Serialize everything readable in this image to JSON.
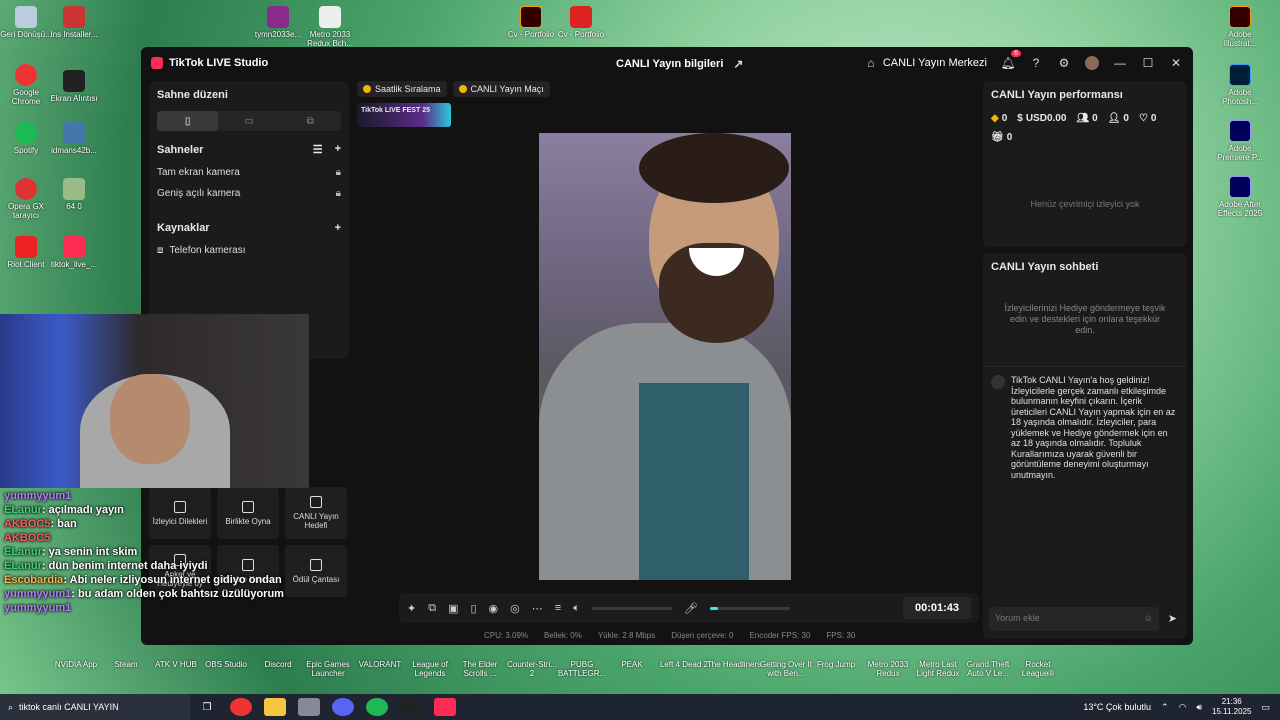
{
  "desktop": {
    "left_icons": [
      "Geri Dönüşü...",
      "Google Chrome",
      "Spotify",
      "Opera GX tarayıcı",
      "Riot Client"
    ],
    "top_icons": [
      "Ins Installer...",
      "tymn2033e...",
      "Metro 2033 Redux Bch...",
      "Cv - Portfolio",
      "Cv - Portfolio"
    ],
    "right_icons": [
      "Adobe Illustrat...",
      "Adobe Photosh...",
      "Adobe Premiere P...",
      "Adobe After Effects 2025"
    ],
    "second_col": [
      "Ekran Alıntısı",
      "idmans42b...",
      "64 0",
      "tiktok_live_..."
    ],
    "bottom_row": [
      "NVIDIA App",
      "Steam",
      "ATK V HUB",
      "OBS Studio",
      "Discord",
      "Epic Games Launcher",
      "VALORANT",
      "League of Legends",
      "The Elder Scrolls ...",
      "Counter-Stri... 2",
      "PUBG BATTLEGR...",
      "PEAK",
      "Left 4 Dead 2",
      "The Headliners",
      "Getting Over It with Ben...",
      "Frog Jump",
      "Metro 2033 Redux",
      "Metro Last Light Redux",
      "Grand Theft Auto V Le...",
      "Rocket League®"
    ]
  },
  "window": {
    "app_title": "TikTok LIVE Studio",
    "center_title": "CANLI Yayın bilgileri",
    "live_center": "CANLI Yayın Merkezi",
    "notification_count": "6"
  },
  "left_panel": {
    "title": "Sahne düzeni",
    "scenes_title": "Sahneler",
    "scenes": [
      "Tam ekran kamera",
      "Geniş açılı kamera"
    ],
    "sources_title": "Kaynaklar",
    "sources": [
      "Telefon kamerası"
    ]
  },
  "tools": [
    {
      "label": "İzleyici Dilekleri"
    },
    {
      "label": "Birlikte Oyna"
    },
    {
      "label": "CANLI Yayın Hedefi"
    },
    {
      "label": "Anket ve Hediyeyle oy"
    },
    {
      "label": "Hazine Kutusu"
    },
    {
      "label": "Ödül Çantası"
    }
  ],
  "tags": [
    "Saatlik Sıralama",
    "CANLI Yayın Maçı"
  ],
  "fest_banner": "TikTok LIVE FEST 25",
  "control_bar": {
    "timer": "00:01:43",
    "volume_level": 0.1
  },
  "stats": {
    "cpu": "CPU: 3.09%",
    "memory": "Bellek: 0%",
    "upload": "Yükle: 2.8 Mbps",
    "dropped": "Düşen çerçeve: 0",
    "encoder": "Encoder FPS: 30",
    "fps": "FPS: 30"
  },
  "performance": {
    "title": "CANLI Yayın performansı",
    "diamonds": "0",
    "usd": "USD0.00",
    "viewers": "0",
    "followers": "0",
    "likes": "0",
    "gifts": "0",
    "empty_text": "Henüz çevrimiçi izleyici yok"
  },
  "chat": {
    "title": "CANLI Yayın sohbeti",
    "hint": "İzleyicilerinizi Hediye göndermeye teşvik edin ve destekleri için onlara teşekkür edin.",
    "welcome": "TikTok CANLI Yayın'a hoş geldiniz! İzleyicilerle gerçek zamanlı etkileşimde bulunmanın keyfini çıkarın. İçerik üreticileri CANLI Yayın yapmak için en az 18 yaşında olmalıdır. İzleyiciler, para yüklemek ve Hediye göndermek için en az 18 yaşında olmalıdır. Topluluk Kurallarımıza uyarak güvenli bir görüntüleme deneyimi oluşturmayı unutmayın.",
    "input_placeholder": "Yorum ekle"
  },
  "overlay_chat": [
    {
      "user": "yummyyum1",
      "text": "",
      "color": "#b57cff"
    },
    {
      "user": "ELanur",
      "text": ": açılmadı yayın",
      "color": "#3fd17a"
    },
    {
      "user": "AKBOC5",
      "text": ": ban",
      "color": "#ff5a5a"
    },
    {
      "user": "AKBOC5",
      "text": "",
      "color": "#ff5a5a"
    },
    {
      "user": "ELanur",
      "text": ": ya senin int skim",
      "color": "#3fd17a"
    },
    {
      "user": "ELanur",
      "text": ": dün benim internet daha iyiydi",
      "color": "#3fd17a"
    },
    {
      "user": "Escobardia",
      "text": ": Abi neler izliyosun internet gidiyo ondan",
      "color": "#f5b84a"
    },
    {
      "user": "yummyyum1",
      "text": ": bu adam olden çok bahtsız üzülüyorum",
      "color": "#b57cff"
    },
    {
      "user": "yummyyum1",
      "text": "",
      "color": "#b57cff"
    }
  ],
  "taskbar": {
    "search_text": "tiktok canlı CANLI YAYIN",
    "weather": "13°C  Çok bulutlu",
    "time": "21:36",
    "date": "15.11.2025"
  }
}
